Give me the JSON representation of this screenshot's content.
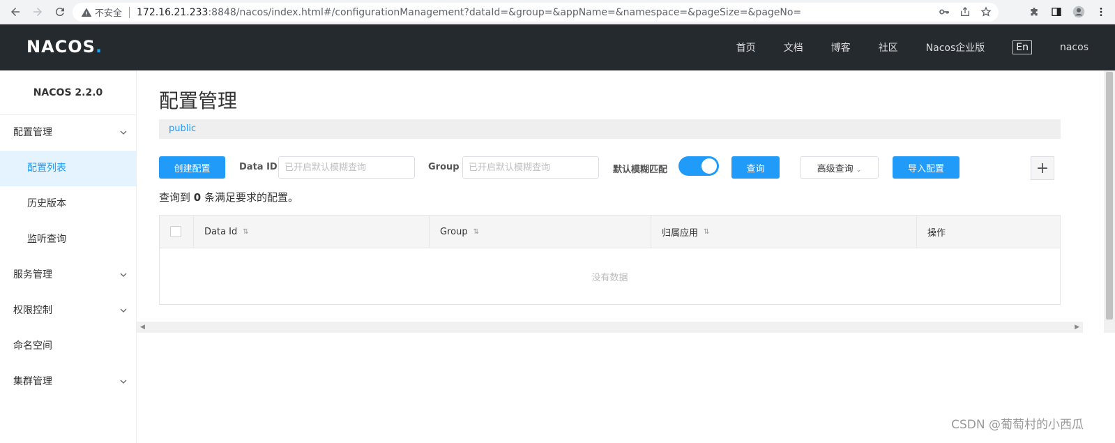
{
  "browser": {
    "insecure_label": "不安全",
    "url_host": "172.16.21.233",
    "url_rest": ":8848/nacos/index.html#/configurationManagement?dataId=&group=&appName=&namespace=&pageSize=&pageNo="
  },
  "header": {
    "logo_text": "NACOS",
    "logo_dot": ".",
    "nav": [
      "首页",
      "文档",
      "博客",
      "社区",
      "Nacos企业版"
    ],
    "lang": "En",
    "user": "nacos"
  },
  "sidebar": {
    "version": "NACOS 2.2.0",
    "items": [
      {
        "label": "配置管理"
      },
      {
        "label": "配置列表"
      },
      {
        "label": "历史版本"
      },
      {
        "label": "监听查询"
      },
      {
        "label": "服务管理"
      },
      {
        "label": "权限控制"
      },
      {
        "label": "命名空间"
      },
      {
        "label": "集群管理"
      }
    ]
  },
  "main": {
    "title": "配置管理",
    "namespace": "public",
    "create_btn": "创建配置",
    "dataid_label": "Data ID",
    "dataid_placeholder": "已开启默认模糊查询",
    "group_label": "Group",
    "group_placeholder": "已开启默认模糊查询",
    "fuzzy_label": "默认模糊匹配",
    "search_btn": "查询",
    "advanced_btn": "高级查询",
    "import_btn": "导入配置",
    "plus_btn": "+",
    "result_prefix": "查询到",
    "result_count": "0",
    "result_suffix": "条满足要求的配置。",
    "columns": [
      "Data Id",
      "Group",
      "归属应用",
      "操作"
    ],
    "empty_text": "没有数据"
  },
  "watermark": "CSDN @葡萄村的小西瓜",
  "colors": {
    "primary": "#209bfa",
    "header_bg": "#252a2f",
    "active_bg": "#e4f3fe"
  }
}
